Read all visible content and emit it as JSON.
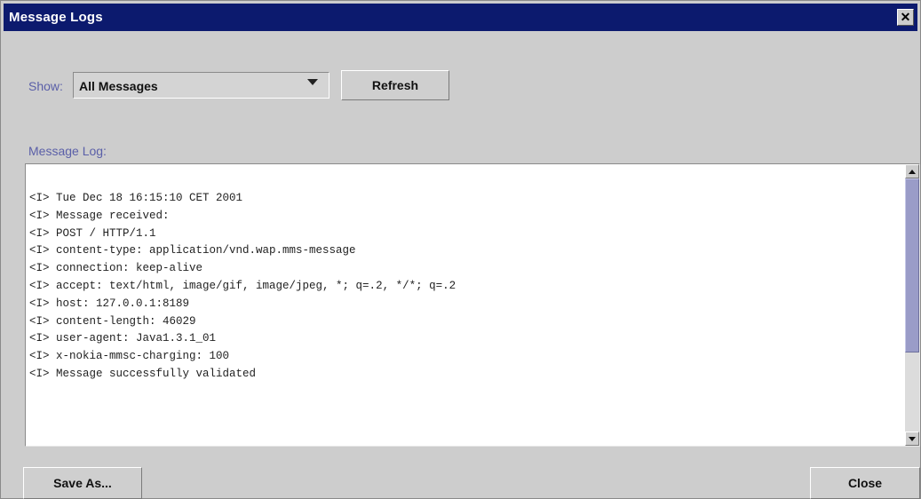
{
  "window": {
    "title": "Message Logs",
    "close_glyph": "✕"
  },
  "filter": {
    "label": "Show:",
    "selected": "All Messages"
  },
  "toolbar": {
    "refresh_label": "Refresh"
  },
  "log": {
    "label": "Message Log:",
    "lines": [
      "<I> Tue Dec 18 16:15:10 CET 2001",
      "<I> Message received:",
      "<I> POST / HTTP/1.1",
      "<I> content-type: application/vnd.wap.mms-message",
      "<I> connection: keep-alive",
      "<I> accept: text/html, image/gif, image/jpeg, *; q=.2, */*; q=.2",
      "<I> host: 127.0.0.1:8189",
      "<I> content-length: 46029",
      "<I> user-agent: Java1.3.1_01",
      "<I> x-nokia-mmsc-charging: 100",
      "<I> Message successfully validated"
    ]
  },
  "footer": {
    "save_as_label": "Save As...",
    "close_label": "Close"
  },
  "colors": {
    "titlebar": "#0c1a6e",
    "label_accent": "#5a5fa8",
    "scroll_thumb": "#9a9cc8",
    "window_bg": "#cdcdcd"
  }
}
